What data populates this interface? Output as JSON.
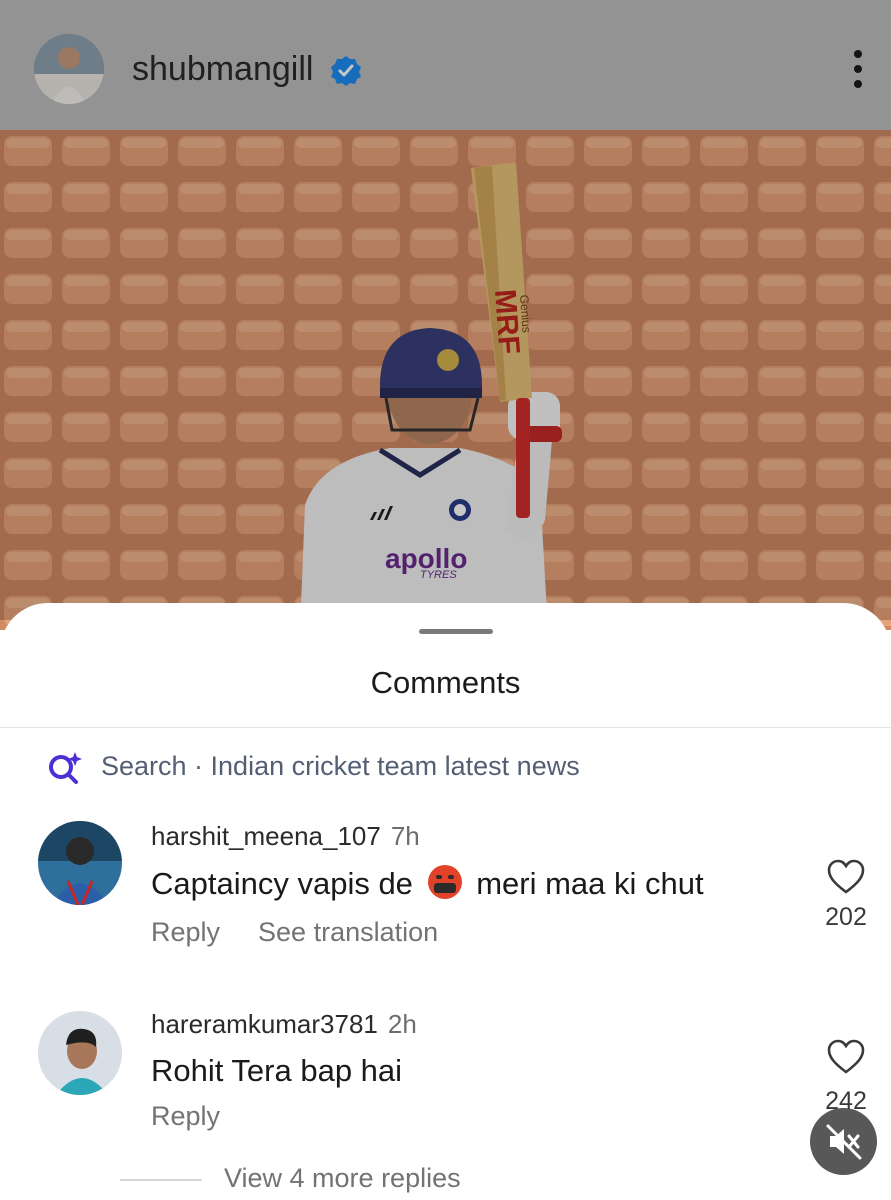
{
  "header": {
    "username": "shubmangill",
    "verified_icon": "verified-badge-icon",
    "more_icon": "more-vertical-icon"
  },
  "post": {
    "bat_brand": "MRF",
    "bat_model": "Genius",
    "shirt_sponsor": "apollo",
    "shirt_sponsor_sub": "TYRES"
  },
  "sheet": {
    "title": "Comments",
    "search_label": "Search · Indian cricket team latest news",
    "search_icon": "ai-search-icon"
  },
  "comments": [
    {
      "username": "harshit_meena_107",
      "time": "7h",
      "text_before": "Captaincy vapis de",
      "emoji": "angry-face-emoji",
      "text_after": "meri maa ki chut",
      "reply_label": "Reply",
      "translate_label": "See translation",
      "likes": "202"
    },
    {
      "username": "hareramkumar3781",
      "time": "2h",
      "text": "Rohit Tera bap hai",
      "reply_label": "Reply",
      "likes": "242"
    }
  ],
  "view_more_replies": "View 4 more replies",
  "colors": {
    "accent_search": "#4e2fd6",
    "verified": "#1e8cf0",
    "post_bg": "#c8876a"
  }
}
